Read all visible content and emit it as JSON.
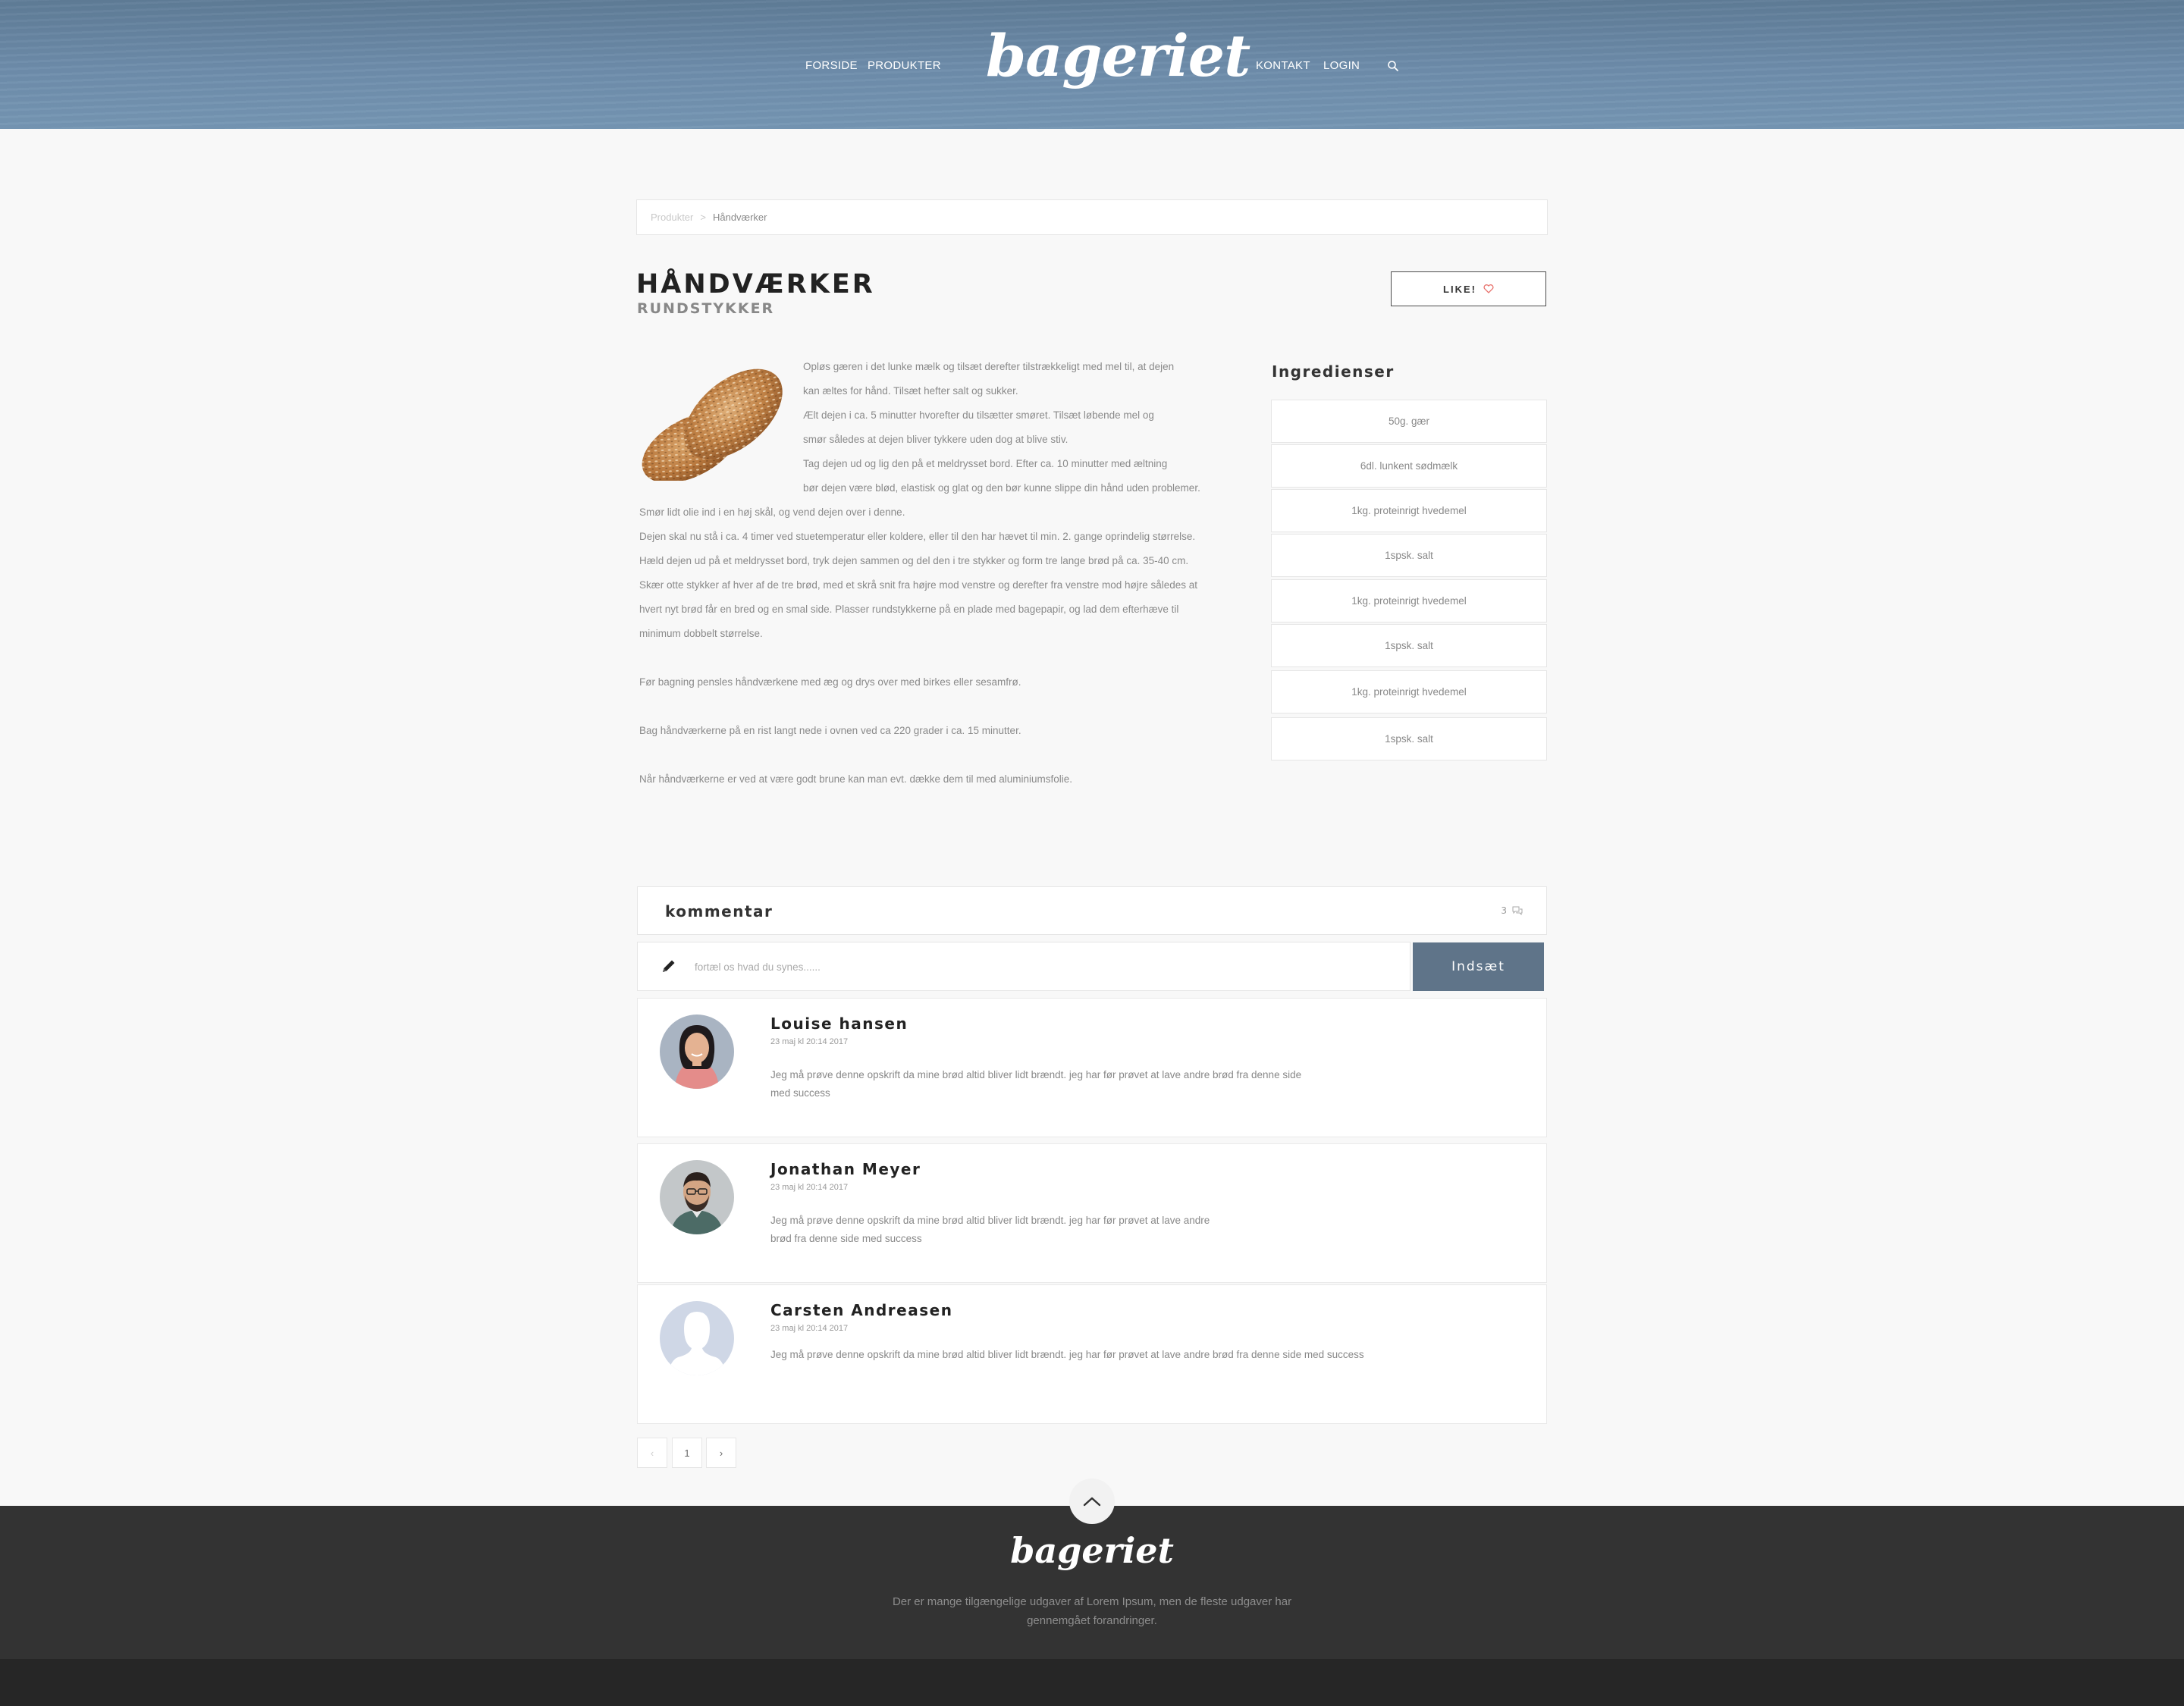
{
  "nav": {
    "forside": "FORSIDE",
    "produkter": "PRODUKTER",
    "kontakt": "KONTAKT",
    "login": "LOGIN"
  },
  "brand": {
    "logo": "bageriet"
  },
  "breadcrumb": {
    "parent": "Produkter",
    "separator": ">",
    "current": "Håndværker"
  },
  "product": {
    "title": "HÅNDVÆRKER",
    "subtitle": "RUNDSTYKKER",
    "like_label": "LIKE!"
  },
  "recipe": {
    "lines": [
      "Opløs gæren i det lunke mælk og tilsæt derefter tilstrækkeligt med mel til, at dejen",
      "kan æltes for hånd. Tilsæt hefter salt og sukker.",
      "Ælt dejen i ca. 5 minutter hvorefter du tilsætter smøret. Tilsæt løbende mel og",
      "smør således at dejen bliver tykkere uden dog at blive stiv.",
      "Tag dejen ud og lig den på et meldrysset bord. Efter ca. 10 minutter med æltning",
      "bør dejen være blød, elastisk og glat og den bør kunne slippe din hånd uden problemer.",
      "Smør lidt olie ind i en høj skål, og vend dejen over i denne.",
      "Dejen skal nu stå i ca. 4 timer ved stuetemperatur eller koldere, eller til den har hævet til min. 2. gange oprindelig størrelse.",
      "Hæld dejen ud på et meldrysset bord, tryk dejen sammen og del den i tre stykker og form tre lange brød på ca. 35-40 cm.",
      "Skær otte stykker af hver af de tre brød, med et skrå snit fra højre mod venstre og derefter fra venstre mod højre således at",
      "hvert nyt brød får en bred og en smal side. Plasser rundstykkerne på en plade med bagepapir, og lad dem efterhæve til",
      "minimum dobbelt størrelse.",
      "Før bagning pensles håndværkene med æg og drys over med birkes eller sesamfrø.",
      "Bag håndværkerne på en rist langt nede i ovnen ved ca 220 grader i ca. 15 minutter.",
      "Når håndværkerne er ved at være godt brune kan man evt. dække dem til med aluminiumsfolie."
    ]
  },
  "ingredients": {
    "title": "Ingredienser",
    "items": [
      "50g. gær",
      "6dl. lunkent sødmælk",
      "1kg. proteinrigt hvedemel",
      "1spsk. salt",
      "1kg. proteinrigt hvedemel",
      "1spsk. salt",
      "1kg. proteinrigt hvedemel",
      "1spsk. salt"
    ]
  },
  "comments": {
    "title": "kommentar",
    "count": "3",
    "placeholder": "fortæl os hvad du synes......",
    "submit_label": "Indsæt",
    "items": [
      {
        "name": "Louise hansen",
        "date": "23 maj kl 20:14 2017",
        "text_line1": "Jeg må prøve denne opskrift da mine brød altid bliver lidt brændt. jeg har før prøvet at lave andre brød fra denne side",
        "text_line2": "med success"
      },
      {
        "name": "Jonathan Meyer",
        "date": "23 maj kl 20:14 2017",
        "text_line1": "Jeg må prøve denne opskrift da mine brød altid bliver lidt brændt. jeg har før prøvet at lave andre",
        "text_line2": "brød fra denne side med success"
      },
      {
        "name": "Carsten Andreasen",
        "date": "23 maj kl 20:14 2017",
        "text_line1": "Jeg må prøve denne opskrift da mine brød altid bliver lidt brændt. jeg har før prøvet at lave andre brød fra denne side med success",
        "text_line2": ""
      }
    ]
  },
  "pagination": {
    "prev": "‹",
    "page": "1",
    "next": "›"
  },
  "footer": {
    "logo": "bageriet",
    "text_line1": "Der er mange tilgængelige udgaver af Lorem Ipsum, men de fleste udgaver har",
    "text_line2": "gennemgået forandringer."
  },
  "colors": {
    "header_blue": "#6e8dab",
    "submit_button": "#5f7489",
    "footer": "#333333",
    "like_heart": "#e8736e"
  }
}
